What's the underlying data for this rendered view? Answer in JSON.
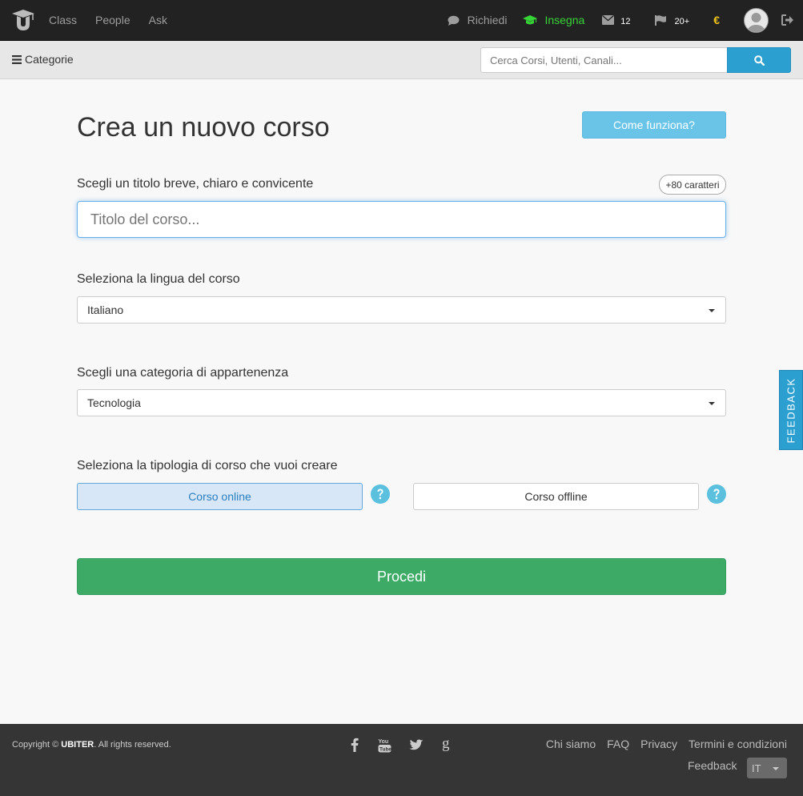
{
  "topbar": {
    "nav": [
      "Class",
      "People",
      "Ask"
    ],
    "richiedi_label": "Richiedi",
    "insegna_label": "Insegna",
    "messages_count": "12",
    "notifications_count": "20+",
    "currency_symbol": "€"
  },
  "subbar": {
    "categories_label": "Categorie",
    "search_placeholder": "Cerca Corsi, Utenti, Canali..."
  },
  "main": {
    "page_title": "Crea un nuovo corso",
    "how_button": "Come funziona?",
    "title_label": "Scegli un titolo breve, chiaro e convicente",
    "char_badge": "+80 caratteri",
    "title_placeholder": "Titolo del corso...",
    "language_label": "Seleziona la lingua del corso",
    "language_value": "Italiano",
    "category_label": "Scegli una categoria di appartenenza",
    "category_value": "Tecnologia",
    "type_label": "Seleziona la tipologia di corso che vuoi creare",
    "type_online": "Corso online",
    "type_offline": "Corso offline",
    "proceed_button": "Procedi"
  },
  "feedback_tab": "FEEDBACK",
  "footer": {
    "copyright_prefix": "Copyright © ",
    "brand": "UBITER",
    "copyright_suffix": ". All rights reserved.",
    "links": [
      "Chi siamo",
      "FAQ",
      "Privacy",
      "Termini e condizioni"
    ],
    "feedback_link": "Feedback",
    "language": "IT"
  },
  "colors": {
    "navbar_bg": "#222222",
    "accent_blue": "#2a9fd0",
    "insegna_green": "#37d437",
    "proceed_green": "#3daa66",
    "footer_bg": "#353535"
  },
  "icons": [
    "logo-icon",
    "chat-icon",
    "graduation-cap-icon",
    "envelope-icon",
    "flag-icon",
    "avatar",
    "logout-icon",
    "bars-icon",
    "search-icon",
    "help-icon",
    "facebook-icon",
    "youtube-icon",
    "twitter-icon",
    "google-icon"
  ]
}
